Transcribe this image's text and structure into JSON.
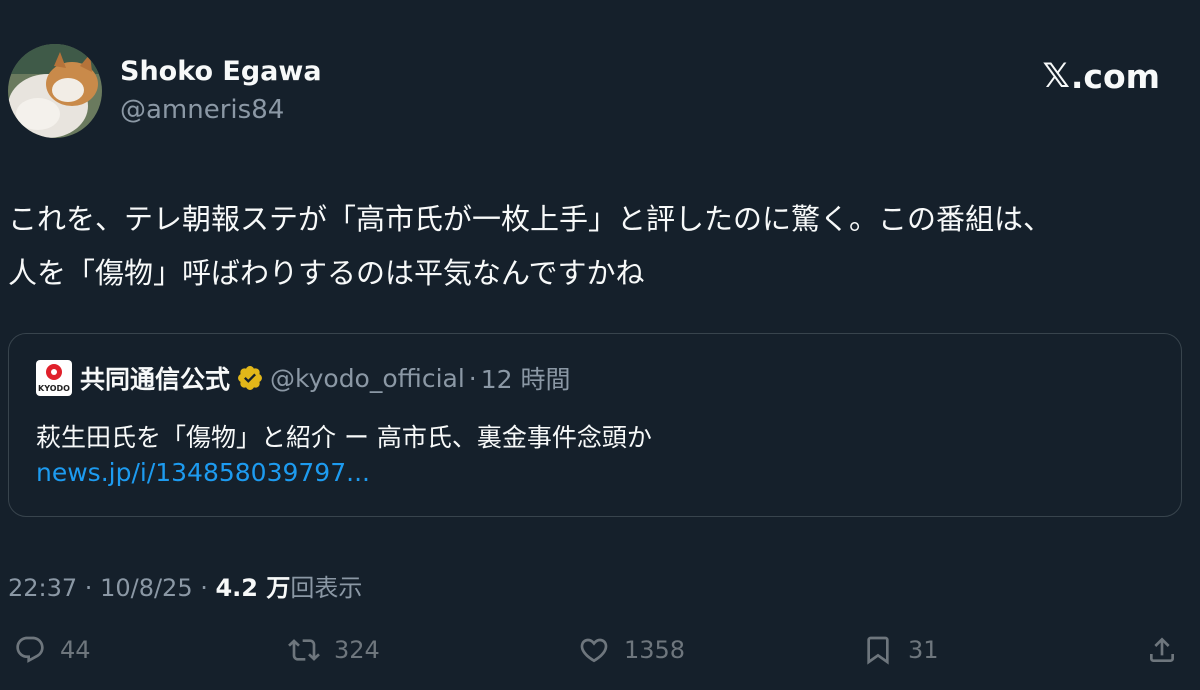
{
  "header": {
    "author_name": "Shoko Egawa",
    "author_handle": "@amneris84",
    "brand_text": ".com",
    "brand_icon": "x-logo-icon",
    "avatar_icon": "cat-avatar-icon"
  },
  "tweet": {
    "text": "これを、テレ朝報ステが「高市氏が一枚上手」と評したのに驚く。この番組は、\n人を「傷物」呼ばわりするのは平気なんですかね"
  },
  "quote": {
    "logo_text": "KYODO",
    "name": "共同通信公式",
    "verified_icon": "verified-gold-badge-icon",
    "handle": "@kyodo_official",
    "separator": "·",
    "time": "12 時間",
    "body": "萩生田氏を「傷物」と紹介 ー 高市氏、裏金事件念頭か",
    "link": "news.jp/i/134858039797..."
  },
  "meta": {
    "time": "22:37",
    "sep1": " · ",
    "date": "10/8/25",
    "sep2": " · ",
    "views_count": "4.2 万",
    "views_label": "回表示"
  },
  "actions": {
    "reply_count": "44",
    "retweet_count": "324",
    "like_count": "1358",
    "bookmark_count": "31"
  },
  "colors": {
    "background": "#15202b",
    "text_primary": "#f7f9f9",
    "text_secondary": "#8b98a5",
    "link": "#1d9bf0",
    "verified_gold": "#e2b719",
    "card_border": "#38444d"
  }
}
